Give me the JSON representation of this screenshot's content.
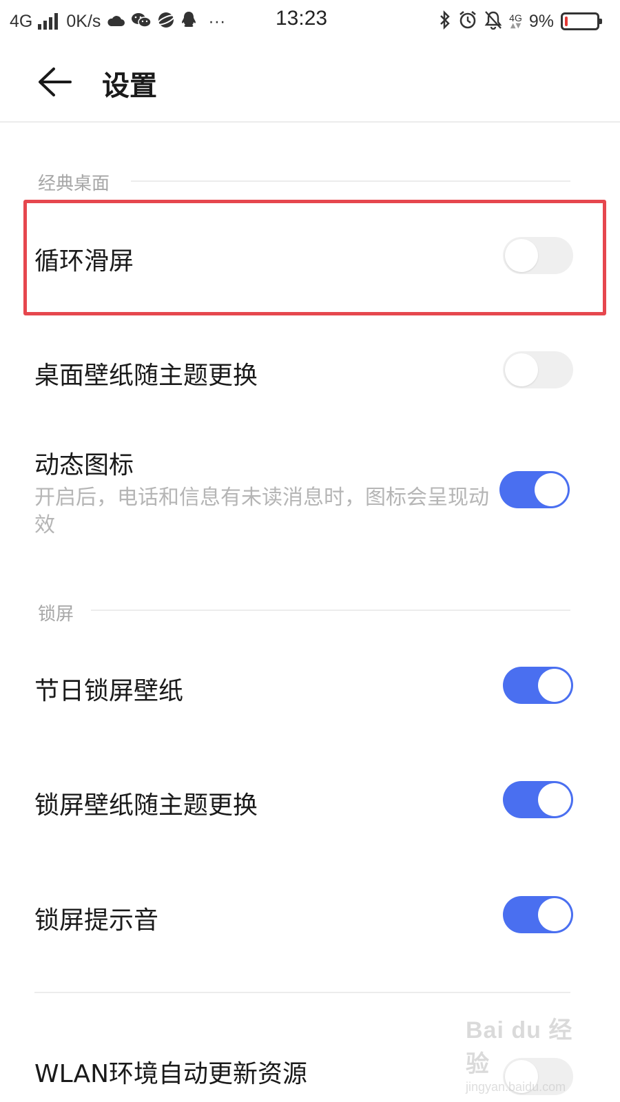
{
  "status_bar": {
    "network": "4G",
    "speed": "0K/s",
    "icons_left": [
      "weather-icon",
      "wechat-icon",
      "browser-icon",
      "qq-icon"
    ],
    "more": "···",
    "time": "13:23",
    "icons_right": [
      "bluetooth-icon",
      "alarm-icon",
      "mute-icon"
    ],
    "network_right": "4G",
    "battery_percent": "9%",
    "battery_level": 0.09,
    "battery_color": "#e53935"
  },
  "header": {
    "title": "设置"
  },
  "sections": [
    {
      "title": "经典桌面",
      "items": [
        {
          "label": "循环滑屏",
          "enabled": false
        },
        {
          "label": "桌面壁纸随主题更换",
          "enabled": false
        },
        {
          "label": "动态图标",
          "description": "开启后，电话和信息有未读消息时，图标会呈现动效",
          "enabled": true
        }
      ]
    },
    {
      "title": "锁屏",
      "items": [
        {
          "label": "节日锁屏壁纸",
          "enabled": true
        },
        {
          "label": "锁屏壁纸随主题更换",
          "enabled": true
        },
        {
          "label": "锁屏提示音",
          "enabled": true
        },
        {
          "label": "WLAN环境自动更新资源",
          "enabled": false
        }
      ]
    }
  ],
  "watermark": {
    "main": "Bai du 经验",
    "sub": "jingyan.baidu.com"
  },
  "colors": {
    "accent": "#4a6ff0",
    "highlight": "#e6474e"
  }
}
